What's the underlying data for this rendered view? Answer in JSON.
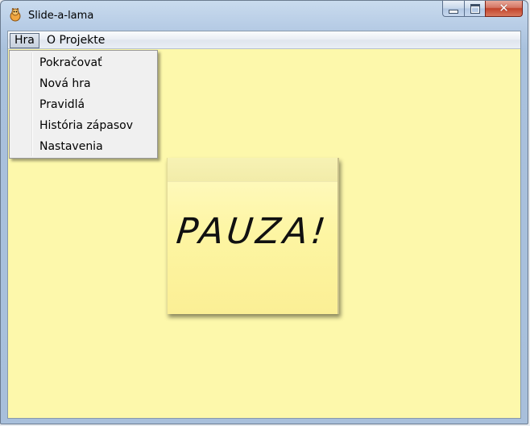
{
  "window": {
    "title": "Slide-a-lama",
    "close_glyph": "✕"
  },
  "menubar": {
    "hra": "Hra",
    "o_projekte": "O Projekte"
  },
  "dropdown": {
    "items": [
      {
        "label": "Pokračovať"
      },
      {
        "label": "Nová hra"
      },
      {
        "label": "Pravidlá"
      },
      {
        "label": "História zápasov"
      },
      {
        "label": "Nastavenia"
      }
    ]
  },
  "note": {
    "text": "PAUZA!"
  },
  "colors": {
    "board": "#fdf8ab",
    "note": "#fdf5a2",
    "close_button": "#c2432a"
  },
  "icons": {
    "app": "llama-icon",
    "minimize": "minimize-icon",
    "maximize": "maximize-icon",
    "close": "close-icon"
  }
}
